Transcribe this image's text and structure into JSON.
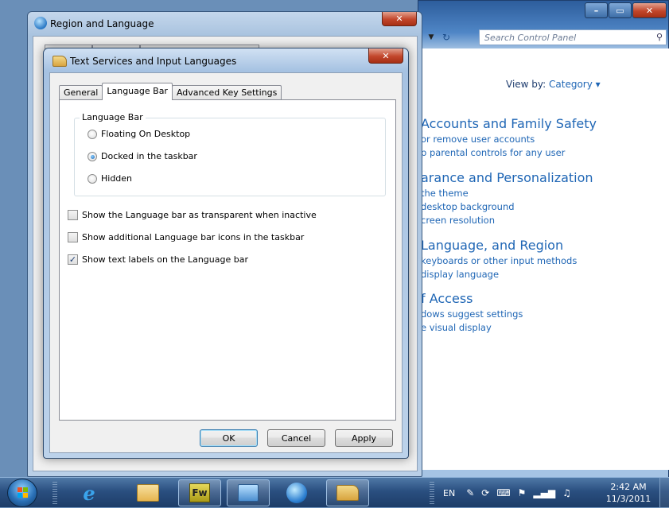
{
  "control_panel": {
    "search_placeholder": "Search Control Panel",
    "search_icon": "search-icon",
    "caption_buttons": {
      "minimize": "–",
      "maximize": "▭",
      "close": "✕"
    },
    "view_by_label": "View by:",
    "view_by_value": "Category",
    "sections": [
      {
        "heading": "Accounts and Family Safety",
        "links": [
          "or remove user accounts",
          "p parental controls for any user"
        ]
      },
      {
        "heading": "arance and Personalization",
        "links": [
          "the theme",
          "desktop background",
          "creen resolution"
        ]
      },
      {
        "heading": " Language, and Region",
        "links": [
          "keyboards or other input methods",
          "display language"
        ]
      },
      {
        "heading": "f Access",
        "links": [
          "dows suggest settings",
          "e visual display"
        ]
      }
    ]
  },
  "region_language": {
    "title": "Region and Language",
    "close_label": "✕"
  },
  "text_services": {
    "title": "Text Services and Input Languages",
    "close_label": "✕",
    "tabs": [
      "General",
      "Language Bar",
      "Advanced Key Settings"
    ],
    "active_tab": "Language Bar",
    "group_label": "Language Bar",
    "radios": [
      {
        "label": "Floating On Desktop",
        "checked": false
      },
      {
        "label": "Docked in the taskbar",
        "checked": true
      },
      {
        "label": "Hidden",
        "checked": false
      }
    ],
    "checkboxes": [
      {
        "label": "Show the Language bar as transparent when inactive",
        "checked": false
      },
      {
        "label": "Show additional Language bar icons in the taskbar",
        "checked": false
      },
      {
        "label": "Show text labels on the Language bar",
        "checked": true
      }
    ],
    "buttons": {
      "ok": "OK",
      "cancel": "Cancel",
      "apply": "Apply"
    }
  },
  "taskbar": {
    "apps": [
      "start-orb",
      "internet-explorer-icon",
      "folder-icon",
      "fireworks-icon",
      "control-panel-icon",
      "region-globe-icon",
      "keyboard-icon"
    ],
    "fireworks_label": "Fw",
    "tray": {
      "language": "EN"
    },
    "clock": {
      "time": "2:42 AM",
      "date": "11/3/2011"
    }
  }
}
